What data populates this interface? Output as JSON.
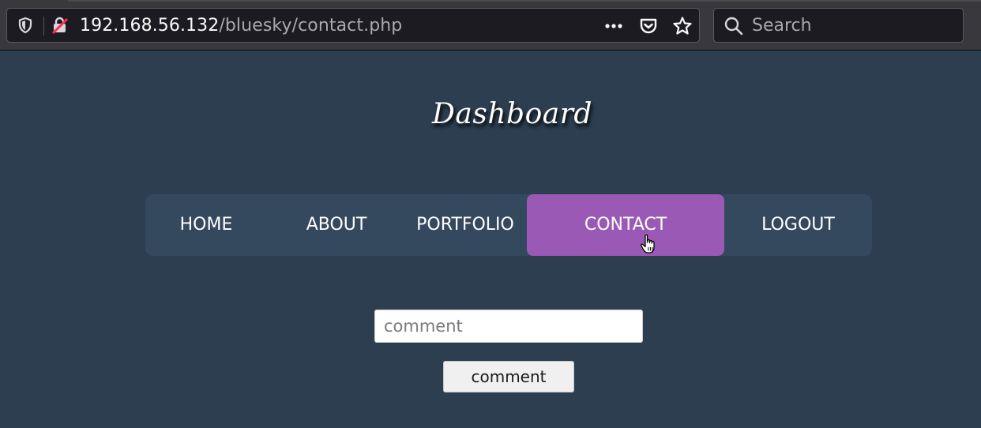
{
  "browser": {
    "url_host": "192.168.56.132",
    "url_path": "/bluesky/contact.php",
    "search_placeholder": "Search",
    "icons": [
      "shield-icon",
      "insecure-lock-icon",
      "page-actions-menu-icon",
      "pocket-icon",
      "bookmark-star-icon",
      "search-icon"
    ]
  },
  "page": {
    "title": "Dashboard",
    "nav": {
      "items": [
        {
          "label": "HOME",
          "active": false
        },
        {
          "label": "ABOUT",
          "active": false
        },
        {
          "label": "PORTFOLIO",
          "active": false
        },
        {
          "label": "CONTACT",
          "active": true
        },
        {
          "label": "LOGOUT",
          "active": false
        }
      ]
    },
    "form": {
      "comment_placeholder": "comment",
      "comment_value": "",
      "submit_label": "comment"
    }
  },
  "colors": {
    "page_background": "#2c3e50",
    "nav_background": "#34495e",
    "nav_active": "#9b59b6",
    "text": "#ffffff"
  }
}
